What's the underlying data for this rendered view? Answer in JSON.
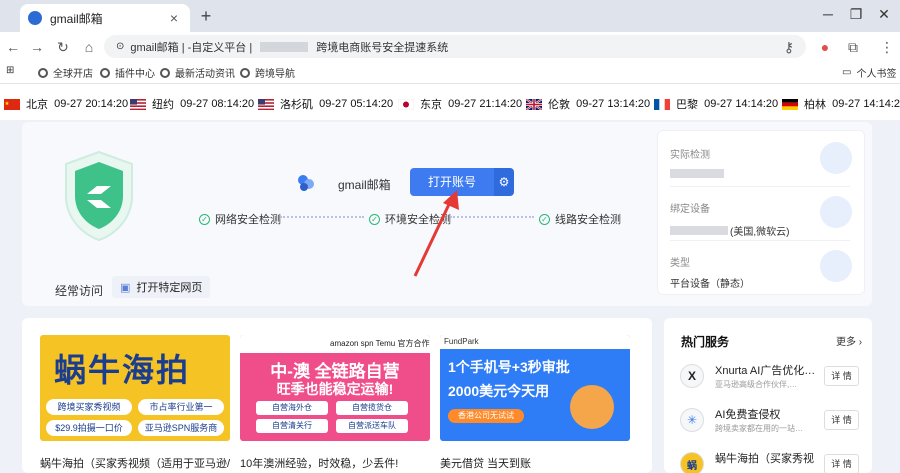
{
  "browser": {
    "tab_title": "gmail邮箱",
    "new_tab": "+",
    "address_prefix": "gmail邮箱 | -自定义平台 |",
    "address_suffix": "跨境电商账号安全提速系统"
  },
  "bookmarks": [
    {
      "label": "全球开店"
    },
    {
      "label": "插件中心"
    },
    {
      "label": "最新活动资讯"
    },
    {
      "label": "跨境导航"
    }
  ],
  "bookmark_folder": "个人书签",
  "clocks": [
    {
      "city": "北京",
      "time": "09-27 20:14:20",
      "flag": "cn"
    },
    {
      "city": "纽约",
      "time": "09-27 08:14:20",
      "flag": "us"
    },
    {
      "city": "洛杉矶",
      "time": "09-27 05:14:20",
      "flag": "us"
    },
    {
      "city": "东京",
      "time": "09-27 21:14:20",
      "flag": "jp"
    },
    {
      "city": "伦敦",
      "time": "09-27 13:14:20",
      "flag": "uk"
    },
    {
      "city": "巴黎",
      "time": "09-27 14:14:20",
      "flag": "fr"
    },
    {
      "city": "柏林",
      "time": "09-27 14:14:20",
      "flag": "de"
    }
  ],
  "main": {
    "account_name": "gmail邮箱",
    "open_button": "打开账号",
    "checks": [
      "网络安全检测",
      "环境安全检测",
      "线路安全检测"
    ],
    "frequent_label": "经常访问",
    "open_page_button": "打开特定网页"
  },
  "side": {
    "detect_title": "实际检测",
    "device_title": "绑定设备",
    "device_value": "(美国,微软云)",
    "type_title": "类型",
    "type_value": "平台设备（静态）"
  },
  "banners": [
    {
      "caption": "蜗牛海拍（买家秀视频（适用于亚马逊/独…",
      "title": "蜗牛海拍",
      "line1a": "跨境买家秀视频",
      "line1b": "市占率行业第一",
      "line2a": "$29.9拍摄一口价",
      "line2b": "亚马逊SPN服务商"
    },
    {
      "caption": "10年澳洲经验，时效稳，少丢件!",
      "top": "amazon spn Temu 官方合作仓",
      "title1": "中-澳 全链路自营",
      "title2": "旺季也能稳定运输!",
      "tags": [
        "自营海外仓",
        "自营清关行",
        "自营揽货仓",
        "自营派送车队"
      ]
    },
    {
      "caption": "美元借贷 当天到账",
      "brand": "FundPark",
      "line1": "1个手机号+3秒审批",
      "line2": "2000美元今天用",
      "btn": "香港公司无试试"
    }
  ],
  "hot": {
    "title": "热门服务",
    "more": "更多",
    "items": [
      {
        "name": "Xnurta AI广告优化…",
        "desc": "亚马逊高级合作伙伴,…",
        "detail": "详 情",
        "icon": "X"
      },
      {
        "name": "AI免费查侵权",
        "desc": "跨境卖家都在用的一站…",
        "detail": "详 情",
        "icon": "✳"
      },
      {
        "name": "蜗牛海拍（买家秀视…",
        "desc": "",
        "detail": "详 情",
        "icon": "蜗"
      }
    ]
  },
  "colors": {
    "accent": "#3e7bf0",
    "success": "#2bb673",
    "arrow": "#e53935"
  }
}
